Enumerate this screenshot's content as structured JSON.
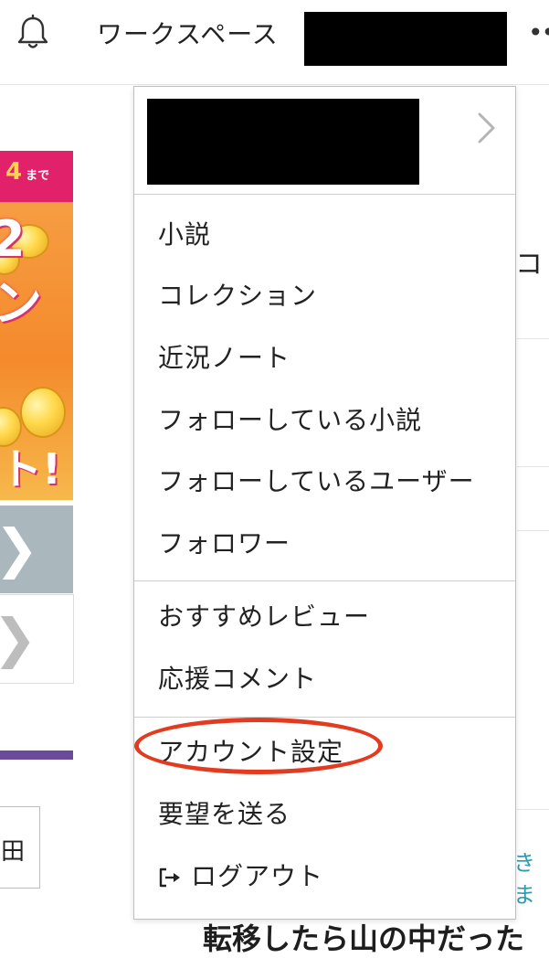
{
  "header": {
    "bell_icon": "bell-icon",
    "workspace_label": "ワークスペース",
    "more_icon": "more-dots-icon",
    "more_glyph": "••"
  },
  "background": {
    "banner": {
      "date_number": "4",
      "date_suffix": "まで",
      "big_char_1": "2",
      "big_char_2": "ン",
      "bottom_text": "ト!"
    },
    "right_char": "コ",
    "right_link_text": "きま",
    "small_button_char": "田",
    "bottom_title": "転移したら山の中だった"
  },
  "menu": {
    "user_chevron_icon": "chevron-right-icon",
    "groups": [
      {
        "items": [
          {
            "label": "小説"
          },
          {
            "label": "コレクション"
          },
          {
            "label": "近況ノート"
          },
          {
            "label": "フォローしている小説"
          },
          {
            "label": "フォローしているユーザー"
          },
          {
            "label": "フォロワー"
          }
        ]
      },
      {
        "items": [
          {
            "label": "おすすめレビュー"
          },
          {
            "label": "応援コメント"
          }
        ]
      },
      {
        "items": [
          {
            "label": "アカウント設定"
          },
          {
            "label": "要望を送る"
          },
          {
            "label": "ログアウト",
            "icon": "logout-icon"
          }
        ]
      }
    ]
  },
  "annotation": {
    "highlight_color": "#e23b1f"
  },
  "colors": {
    "banner_pink": "#e2216b",
    "banner_orange": "#f48a2c",
    "link_teal": "#2a9bb3",
    "purple": "#6b4a9b"
  }
}
